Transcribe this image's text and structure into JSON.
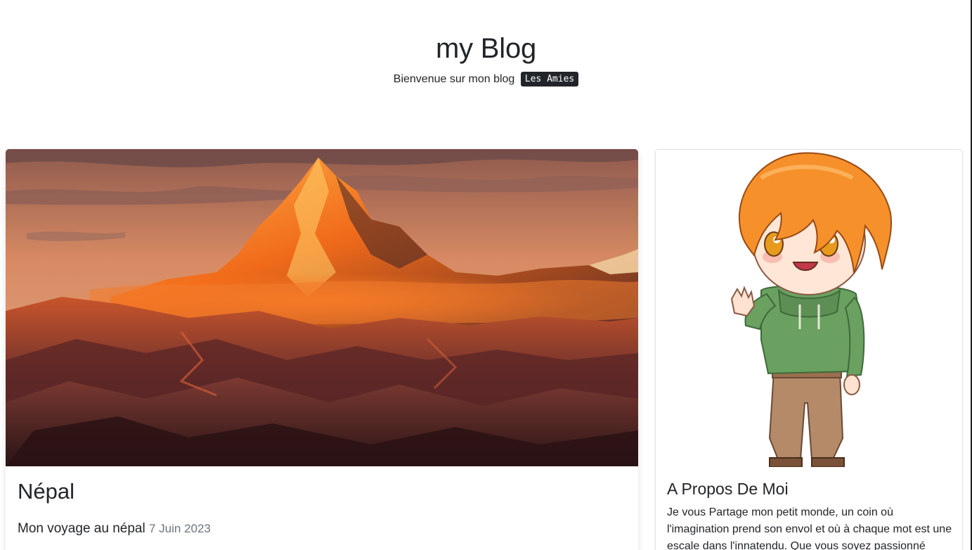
{
  "header": {
    "title": "my Blog",
    "tagline": "Bienvenue sur mon blog",
    "badge": "Les Amies"
  },
  "post": {
    "image_alt": "Montagne au Népal au coucher du soleil",
    "title": "Népal",
    "subtitle": "Mon voyage au népal",
    "date": "7 Juin 2023"
  },
  "about": {
    "image_alt": "Personnage chibi aux cheveux orange",
    "title": "A Propos De Moi",
    "text": "Je vous Partage mon petit monde, un coin où l'imagination prend son envol et où à chaque mot est une escale dans l'innatendu. Que vous soyez passionné"
  },
  "colors": {
    "text": "#212529",
    "muted": "#6c757d",
    "badge_bg": "#212529",
    "sky": "#d9825a",
    "peak_glow": "#ff8a1a",
    "hair": "#f5902b",
    "hoodie": "#6aa060",
    "pants": "#b48a68"
  }
}
